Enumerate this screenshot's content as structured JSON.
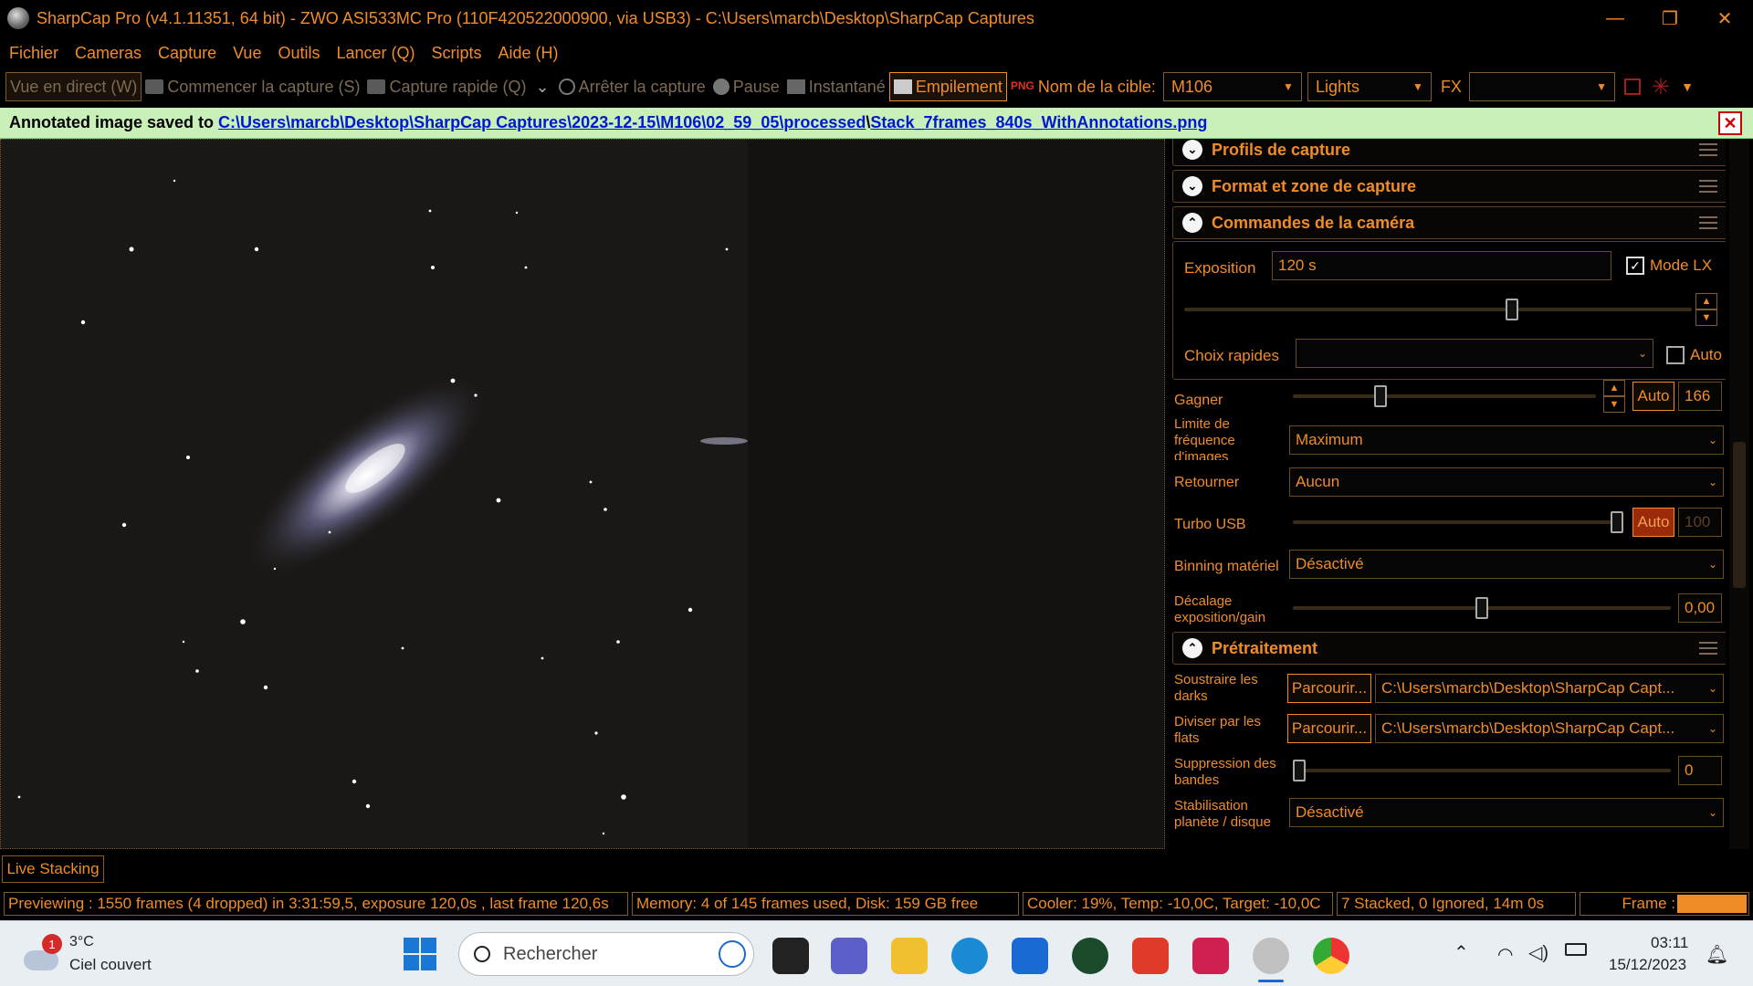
{
  "window": {
    "title": "SharpCap Pro (v4.1.11351, 64 bit) - ZWO ASI533MC Pro (110F420522000900, via USB3) - C:\\Users\\marcb\\Desktop\\SharpCap Captures",
    "controls": {
      "minimize": "—",
      "restore": "❐",
      "close": "✕"
    }
  },
  "menu": [
    "Fichier",
    "Cameras",
    "Capture",
    "Vue",
    "Outils",
    "Lancer (Q)",
    "Scripts",
    "Aide (H)"
  ],
  "toolbar": {
    "live_view": "Vue en direct (W)",
    "start_capture": "Commencer la capture (S)",
    "quick_capture": "Capture rapide (Q)",
    "stop_capture": "Arrêter la capture",
    "pause": "Pause",
    "snapshot": "Instantané",
    "stacking": "Empilement",
    "target_label": "Nom de la cible:",
    "target_value": "M106",
    "frame_type": "Lights",
    "fx_label": "FX",
    "fx_value": ""
  },
  "notification": {
    "prefix": "Annotated image saved to ",
    "link1": "C:\\Users\\marcb\\Desktop\\SharpCap Captures\\2023-12-15\\M106\\02_59_05\\processed",
    "sep": "\\",
    "link2": "Stack_7frames_840s_WithAnnotations.png",
    "close": "✕"
  },
  "panel": {
    "sections": {
      "profiles": "Profils de capture",
      "format": "Format et zone de capture",
      "camera": "Commandes de la caméra",
      "preprocess": "Prétraitement"
    },
    "exposure": {
      "label": "Exposition",
      "value": "120 s",
      "lx_label": "Mode LX",
      "lx_checked": true,
      "slider_fraction": 0.65
    },
    "quick_choices": {
      "label": "Choix rapides",
      "value": "",
      "auto_label": "Auto"
    },
    "gain": {
      "label": "Gagner",
      "auto": "Auto",
      "value": "166",
      "slider_fraction": 0.28
    },
    "frame_limit": {
      "label": "Limite de fréquence d'images",
      "value": "Maximum"
    },
    "flip": {
      "label": "Retourner",
      "value": "Aucun"
    },
    "turbo_usb": {
      "label": "Turbo USB",
      "auto": "Auto",
      "value": "100",
      "slider_fraction": 1.0
    },
    "binning": {
      "label": "Binning matériel",
      "value": "Désactivé"
    },
    "offset": {
      "label": "Décalage exposition/gain",
      "value": "0,00",
      "slider_fraction": 0.5
    },
    "darks": {
      "label": "Soustraire les darks",
      "button": "Parcourir...",
      "path": "C:\\Users\\marcb\\Desktop\\SharpCap Capt..."
    },
    "flats": {
      "label": "Diviser par les flats",
      "button": "Parcourir...",
      "path": "C:\\Users\\marcb\\Desktop\\SharpCap Capt..."
    },
    "banding": {
      "label": "Suppression des bandes",
      "value": "0",
      "slider_fraction": 0.0
    },
    "stabilisation": {
      "label": "Stabilisation planète / disque",
      "value": "Désactivé"
    }
  },
  "live_stacking_tab": "Live Stacking",
  "status": {
    "preview": "Previewing : 1550 frames (4 dropped) in 3:31:59,5, exposure 120,0s , last frame 120,6s",
    "memory": "Memory: 4 of 145 frames used, Disk: 159 GB free",
    "cooler": "Cooler: 19%, Temp: -10,0C, Target: -10,0C",
    "stacked": "7 Stacked, 0 Ignored, 14m 0s",
    "frame_label": "Frame :"
  },
  "taskbar": {
    "weather_temp": "3°C",
    "weather_desc": "Ciel couvert",
    "weather_badge": "1",
    "search_placeholder": "Rechercher",
    "time": "03:11",
    "date": "15/12/2023"
  },
  "colors": {
    "accent": "#f08c28",
    "notif_bg": "#c8f0b8",
    "link": "#0018d0"
  }
}
